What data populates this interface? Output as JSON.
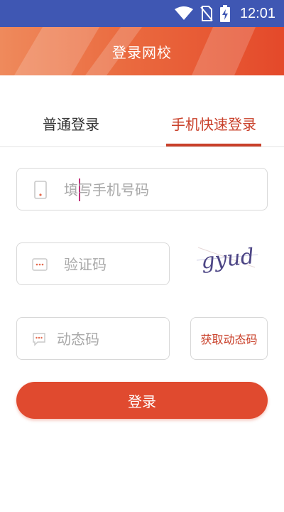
{
  "status_bar": {
    "time": "12:01"
  },
  "header": {
    "title": "登录网校"
  },
  "tabs": {
    "normal_label": "普通登录",
    "fast_label": "手机快速登录"
  },
  "form": {
    "phone_placeholder": "填写手机号码",
    "captcha_placeholder": "验证码",
    "captcha_image_text": "gyud",
    "sms_placeholder": "动态码",
    "get_code_label": "获取动态码",
    "login_label": "登录"
  },
  "colors": {
    "status_bar": "#3f57b3",
    "accent": "#c9402a",
    "login_button": "#e04a2f"
  },
  "icons": [
    "wifi-icon",
    "no-sim-icon",
    "battery-charging-icon",
    "phone-icon",
    "captcha-icon",
    "message-icon"
  ]
}
